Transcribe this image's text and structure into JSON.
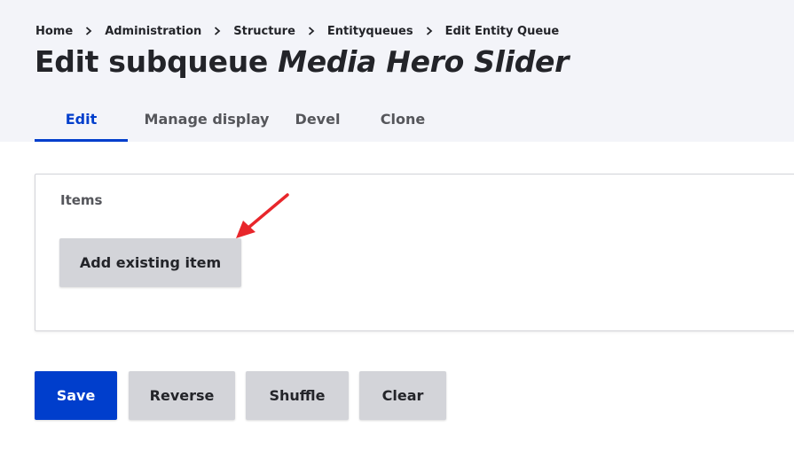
{
  "breadcrumb": [
    "Home",
    "Administration",
    "Structure",
    "Entityqueues",
    "Edit Entity Queue"
  ],
  "page_title": {
    "prefix": "Edit subqueue ",
    "name": "Media Hero Slider"
  },
  "tabs": [
    {
      "label": "Edit",
      "active": true
    },
    {
      "label": "Manage display",
      "active": false
    },
    {
      "label": "Devel",
      "active": false
    },
    {
      "label": "Clone",
      "active": false
    }
  ],
  "items_section": {
    "label": "Items",
    "add_button_label": "Add existing item"
  },
  "actions": {
    "save_label": "Save",
    "reverse_label": "Reverse",
    "shuffle_label": "Shuffle",
    "clear_label": "Clear"
  },
  "colors": {
    "primary": "#003ecc",
    "header_bg": "#f3f4f9",
    "button_gray": "#d3d4d9",
    "annotation_arrow": "#e8262b"
  }
}
